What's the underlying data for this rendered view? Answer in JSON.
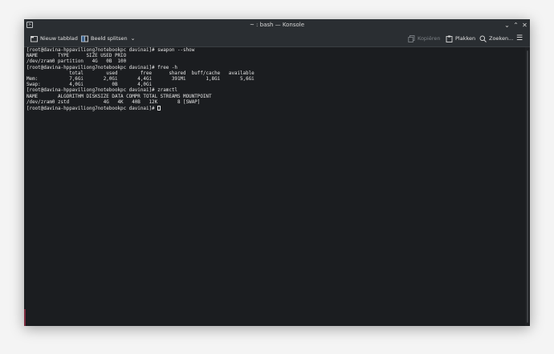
{
  "window": {
    "title": "~ : bash — Konsole",
    "app_icon_glyph": ">",
    "controls": {
      "minimize": "⌄",
      "maximize": "⌃",
      "close": "✕"
    }
  },
  "toolbar": {
    "new_tab_label": "Nieuw tabblad",
    "split_view_label": "Beeld splitsen",
    "split_view_chevron": "⌄",
    "copy_label": "Kopiëren",
    "paste_label": "Plakken",
    "find_label": "Zoeken...",
    "menu_glyph": "☰"
  },
  "terminal": {
    "lines": [
      "[root@davina-hppaviliong7notebookpc davinai]# swapon --show",
      "NAME       TYPE      SIZE USED PRIO",
      "/dev/zram0 partition   4G   0B  100",
      "[root@davina-hppaviliong7notebookpc davinai]# free -h",
      "               total        used        free      shared  buff/cache   available",
      "Mem:           7,6Gi       2,0Gi       4,4Gi       391Mi       1,8Gi       5,6Gi",
      "Swap:          4,0Gi          0B       4,0Gi",
      "[root@davina-hppaviliong7notebookpc davinai]# zramctl",
      "NAME       ALGORITHM DISKSIZE DATA COMPR TOTAL STREAMS MOUNTPOINT",
      "/dev/zram0 zstd            4G   4K   40B   12K       8 [SWAP]"
    ],
    "prompt": "[root@davina-hppaviliong7notebookpc davinai]# "
  },
  "colors": {
    "terminal_bg": "#1b1d20",
    "chrome_bg": "#2a2e32",
    "text": "#e6e6e6",
    "accent_edge": "#7b2b3d"
  }
}
